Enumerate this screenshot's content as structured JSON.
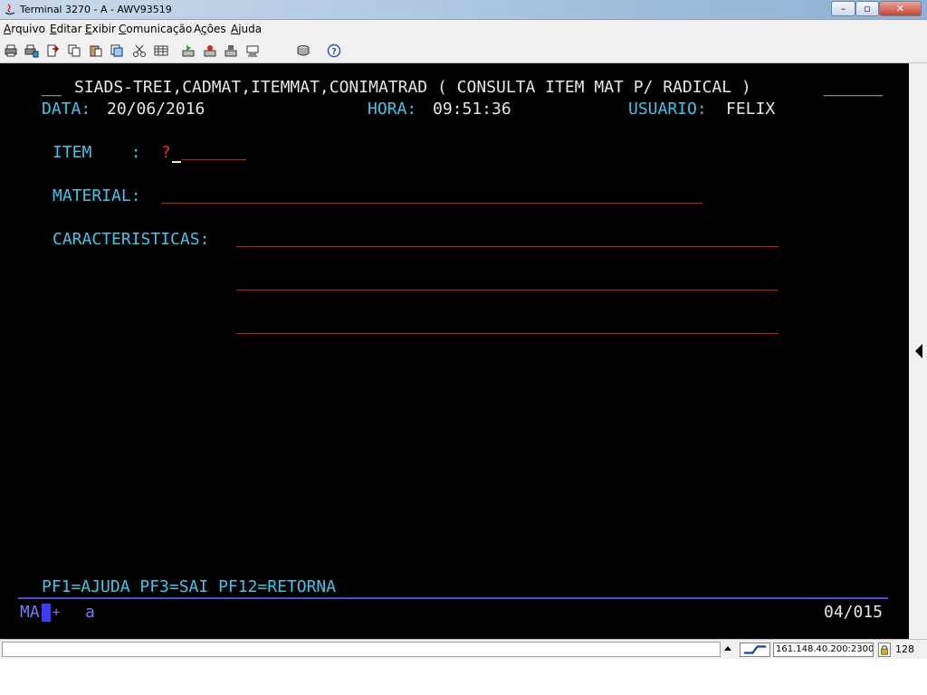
{
  "window": {
    "title": "Terminal 3270 - A - AWV93519",
    "controls": {
      "minimize": "–",
      "maximize": "▫",
      "close": "✕"
    }
  },
  "menu": {
    "items": [
      {
        "u": "A",
        "rest": "rquivo"
      },
      {
        "u": "E",
        "rest": "ditar"
      },
      {
        "u": "E",
        "rest": "xibir"
      },
      {
        "u": "C",
        "rest": "omunicação"
      },
      {
        "pre": "A",
        "u": "ç",
        "rest": "ões"
      },
      {
        "u": "A",
        "rest": "juda"
      }
    ]
  },
  "toolbar": {
    "icons": [
      "print-screen-icon",
      "print-setup-icon",
      "send-file-icon",
      "copy-icon",
      "paste-icon",
      "copy-append-icon",
      "cut-icon",
      "select-all-icon",
      "macro-play-icon",
      "macro-record-icon",
      "macro-stop-icon",
      "keyboard-map-icon",
      "disk-icon",
      "help-icon"
    ]
  },
  "terminal": {
    "header_prefix": "__",
    "header": "SIADS-TREI,CADMAT,ITEMMAT,CONIMATRAD ( CONSULTA ITEM MAT P/ RADICAL )",
    "header_suffix": "______",
    "data_label": "DATA:",
    "data_value": "20/06/2016",
    "hora_label": "HORA:",
    "hora_value": "09:51:36",
    "usuario_label": "USUARIO:",
    "usuario_value": "FELIX",
    "item_label": "ITEM    :",
    "item_value": "?",
    "material_label": "MATERIAL:",
    "caracteristicas_label": "CARACTERISTICAS:",
    "pf_keys": "PF1=AJUDA PF3=SAI PF12=RETORNA"
  },
  "oia": {
    "mode": "MA",
    "plus": "+",
    "indicator": "a",
    "cursor_position": "04/015"
  },
  "statusbar": {
    "host": "161.148.40.200:23000",
    "key_length": "128"
  }
}
